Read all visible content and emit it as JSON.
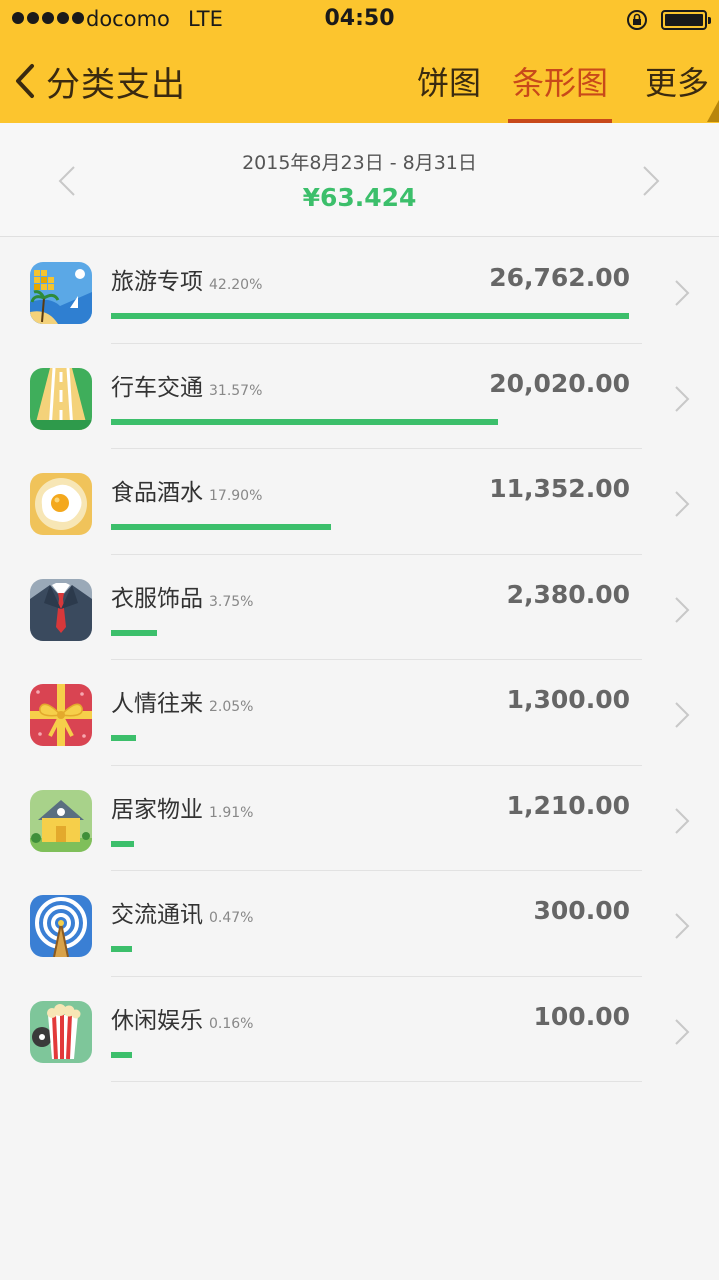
{
  "status_bar": {
    "carrier": "docomo",
    "network": "LTE",
    "time": "04:50"
  },
  "nav": {
    "title": "分类支出",
    "tabs": [
      {
        "label": "饼图",
        "active": false
      },
      {
        "label": "条形图",
        "active": true
      },
      {
        "label": "更多",
        "active": false
      }
    ]
  },
  "period": {
    "range": "2015年8月23日 - 8月31日",
    "total": "¥63.424"
  },
  "colors": {
    "header": "#fcc52e",
    "accent": "#c8491a",
    "bar": "#3cbf6b"
  },
  "categories": [
    {
      "name": "旅游专项",
      "percent": "42.20%",
      "amount": "26,762.00",
      "share": 1.0,
      "icon": "travel-icon"
    },
    {
      "name": "行车交通",
      "percent": "31.57%",
      "amount": "20,020.00",
      "share": 0.748,
      "icon": "road-icon"
    },
    {
      "name": "食品酒水",
      "percent": "17.90%",
      "amount": "11,352.00",
      "share": 0.424,
      "icon": "fried-egg-icon"
    },
    {
      "name": "衣服饰品",
      "percent": "3.75%",
      "amount": "2,380.00",
      "share": 0.089,
      "icon": "suit-icon"
    },
    {
      "name": "人情往来",
      "percent": "2.05%",
      "amount": "1,300.00",
      "share": 0.049,
      "icon": "gift-icon"
    },
    {
      "name": "居家物业",
      "percent": "1.91%",
      "amount": "1,210.00",
      "share": 0.045,
      "icon": "house-icon"
    },
    {
      "name": "交流通讯",
      "percent": "0.47%",
      "amount": "300.00",
      "share": 0.04,
      "icon": "antenna-icon"
    },
    {
      "name": "休闲娱乐",
      "percent": "0.16%",
      "amount": "100.00",
      "share": 0.04,
      "icon": "popcorn-icon"
    }
  ]
}
